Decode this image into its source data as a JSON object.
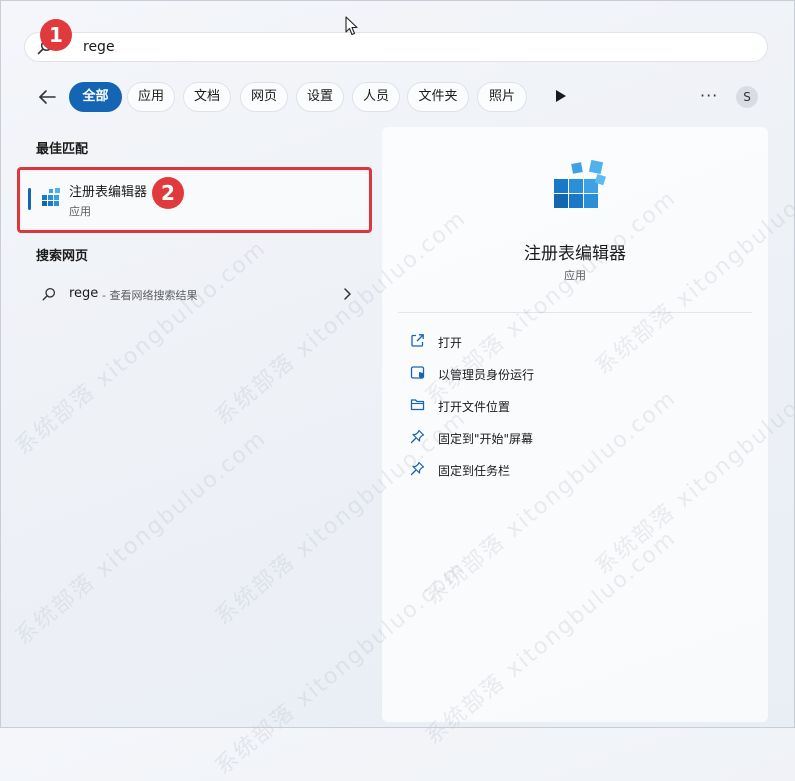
{
  "search": {
    "query": "rege"
  },
  "filters": {
    "tabs": [
      {
        "label": "全部"
      },
      {
        "label": "应用"
      },
      {
        "label": "文档"
      },
      {
        "label": "网页"
      },
      {
        "label": "设置"
      },
      {
        "label": "人员"
      },
      {
        "label": "文件夹"
      },
      {
        "label": "照片"
      }
    ],
    "more_label": "···",
    "avatar_letter": "S"
  },
  "left": {
    "best_match_title": "最佳匹配",
    "best_match": {
      "name": "注册表编辑器",
      "type": "应用",
      "icon": "registry-editor-icon"
    },
    "web_title": "搜索网页",
    "web_item": {
      "query": "rege",
      "suffix": "- 查看网络搜索结果"
    }
  },
  "detail": {
    "name": "注册表编辑器",
    "type": "应用",
    "actions": [
      {
        "label": "打开",
        "icon": "open-external-icon"
      },
      {
        "label": "以管理员身份运行",
        "icon": "admin-shield-icon"
      },
      {
        "label": "打开文件位置",
        "icon": "folder-icon"
      },
      {
        "label": "固定到\"开始\"屏幕",
        "icon": "pin-icon"
      },
      {
        "label": "固定到任务栏",
        "icon": "pin-icon"
      }
    ]
  },
  "annotations": {
    "badge_1": "1",
    "badge_2": "2"
  },
  "watermark": "系统部落 xitongbuluo.com",
  "colors": {
    "accent": "#1565b5",
    "callout": "#d9393b"
  }
}
